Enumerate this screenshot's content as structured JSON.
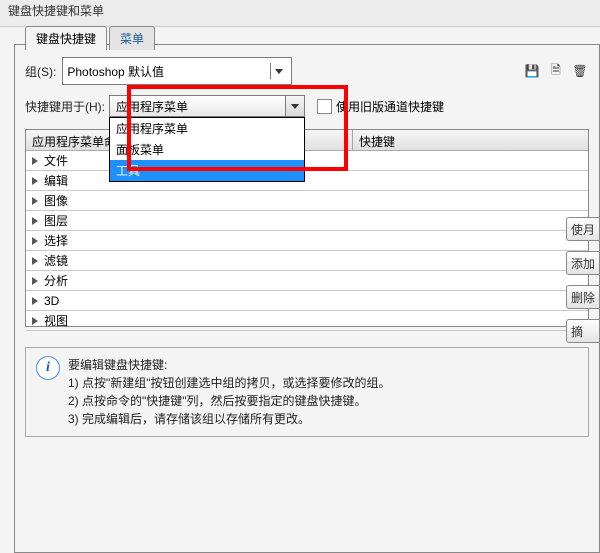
{
  "window_title": "键盘快捷键和菜单",
  "tabs": [
    "键盘快捷键",
    "菜单"
  ],
  "group": {
    "label": "组(S):",
    "value": "Photoshop 默认值"
  },
  "icons": {
    "save": "💾",
    "new": "🗎",
    "trash": "🗑"
  },
  "shortcut_for": {
    "label": "快捷键用于(H):",
    "value": "应用程序菜单",
    "options": [
      "应用程序菜单",
      "面板菜单",
      "工具"
    ],
    "selected_index": 2
  },
  "legacy_checkbox": "使用旧版通道快捷键",
  "grid": {
    "col_cmd": "应用程序菜单命令",
    "col_key": "快捷键",
    "rows": [
      "文件",
      "编辑",
      "图像",
      "图层",
      "选择",
      "滤镜",
      "分析",
      "3D",
      "视图"
    ]
  },
  "side_buttons": [
    "使月",
    "添加",
    "删除",
    "摘"
  ],
  "info": {
    "title": "要编辑键盘快捷键:",
    "l1": "1) 点按\"新建组\"按钮创建选中组的拷贝，或选择要修改的组。",
    "l2": "2) 点按命令的\"快捷键\"列，然后按要指定的键盘快捷键。",
    "l3": "3) 完成编辑后，请存储该组以存储所有更改。"
  }
}
